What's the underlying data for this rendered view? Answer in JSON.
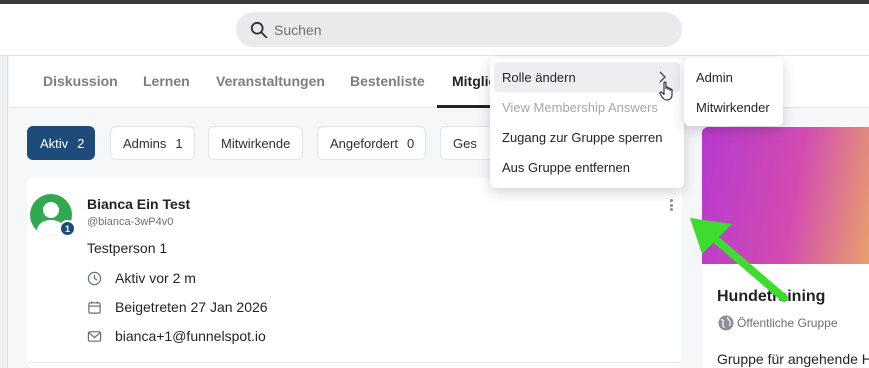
{
  "search": {
    "placeholder": "Suchen",
    "icon": "search-icon"
  },
  "tabs": [
    {
      "label": "Diskussion"
    },
    {
      "label": "Lernen"
    },
    {
      "label": "Veranstaltungen"
    },
    {
      "label": "Bestenliste"
    },
    {
      "label": "Mitglie"
    }
  ],
  "filters": [
    {
      "label": "Aktiv",
      "count": "2"
    },
    {
      "label": "Admins",
      "count": "1"
    },
    {
      "label": "Mitwirkende",
      "count": ""
    },
    {
      "label": "Angefordert",
      "count": "0"
    },
    {
      "label": "Ges",
      "count": ""
    }
  ],
  "member": {
    "name": "Bianca Ein Test",
    "handle": "@bianca-3wP4v0",
    "badge": "1",
    "bio": "Testperson 1",
    "active": "Aktiv vor 2 m",
    "joined": "Beigetreten 27 Jan 2026",
    "email": "bianca+1@funnelspot.io"
  },
  "menu": {
    "items": [
      {
        "label": "Rolle ändern"
      },
      {
        "label": "View Membership Answers"
      },
      {
        "label": "Zugang zur Gruppe sperren"
      },
      {
        "label": "Aus Gruppe entfernen"
      }
    ],
    "submenu": [
      {
        "label": "Admin"
      },
      {
        "label": "Mitwirkender"
      }
    ]
  },
  "group": {
    "title": "Hundetraining",
    "type": "Öffentliche Gruppe",
    "description": "Gruppe für angehende H"
  },
  "colors": {
    "accent": "#1d4b7a",
    "avatar": "#33a852",
    "annotation_arrow": "#3ddc2f"
  }
}
